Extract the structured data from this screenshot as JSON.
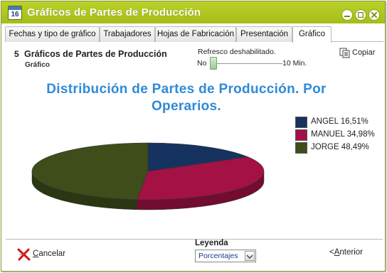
{
  "window": {
    "title": "Gráficos de Partes de Producción",
    "icon_text": "16"
  },
  "tabs": [
    {
      "label": "Fechas y tipo de gráfico",
      "active": false
    },
    {
      "label": "Trabajadores",
      "active": false
    },
    {
      "label": "Hojas de Fabricación",
      "active": false
    },
    {
      "label": "Presentación",
      "active": false
    },
    {
      "label": "Gráfico",
      "active": true
    }
  ],
  "header": {
    "step_number": "5",
    "title": "Gráficos de Partes de Producción",
    "subtitle": "Gráfico"
  },
  "refresh": {
    "label": "Refresco deshabilitado.",
    "min_label": "No",
    "max_label": "10 Min.",
    "value": 0
  },
  "copy": {
    "label": "Copiar"
  },
  "chart_data": {
    "type": "pie",
    "title": "Distribución de Partes de Producción. Por Operarios.",
    "title_lines": [
      "Distribución de Partes de Producción. Por",
      "Operarios."
    ],
    "slices": [
      {
        "label": "ANGEL 16,51%",
        "name": "ANGEL",
        "value": 16.51,
        "color": "#16335f"
      },
      {
        "label": "MANUEL 34,98%",
        "name": "MANUEL",
        "value": 34.98,
        "color": "#a31145"
      },
      {
        "label": "JORGE 48,49%",
        "name": "JORGE",
        "value": 48.49,
        "color": "#3e4d1a"
      }
    ],
    "legend_position": "right",
    "three_d": true
  },
  "footer": {
    "cancel_label": "Cancelar",
    "cancel_mnemonic": "C",
    "legend_label": "Leyenda",
    "legend_value": "Porcentajes",
    "prev_label": "<Anterior",
    "prev_mnemonic": "A"
  }
}
